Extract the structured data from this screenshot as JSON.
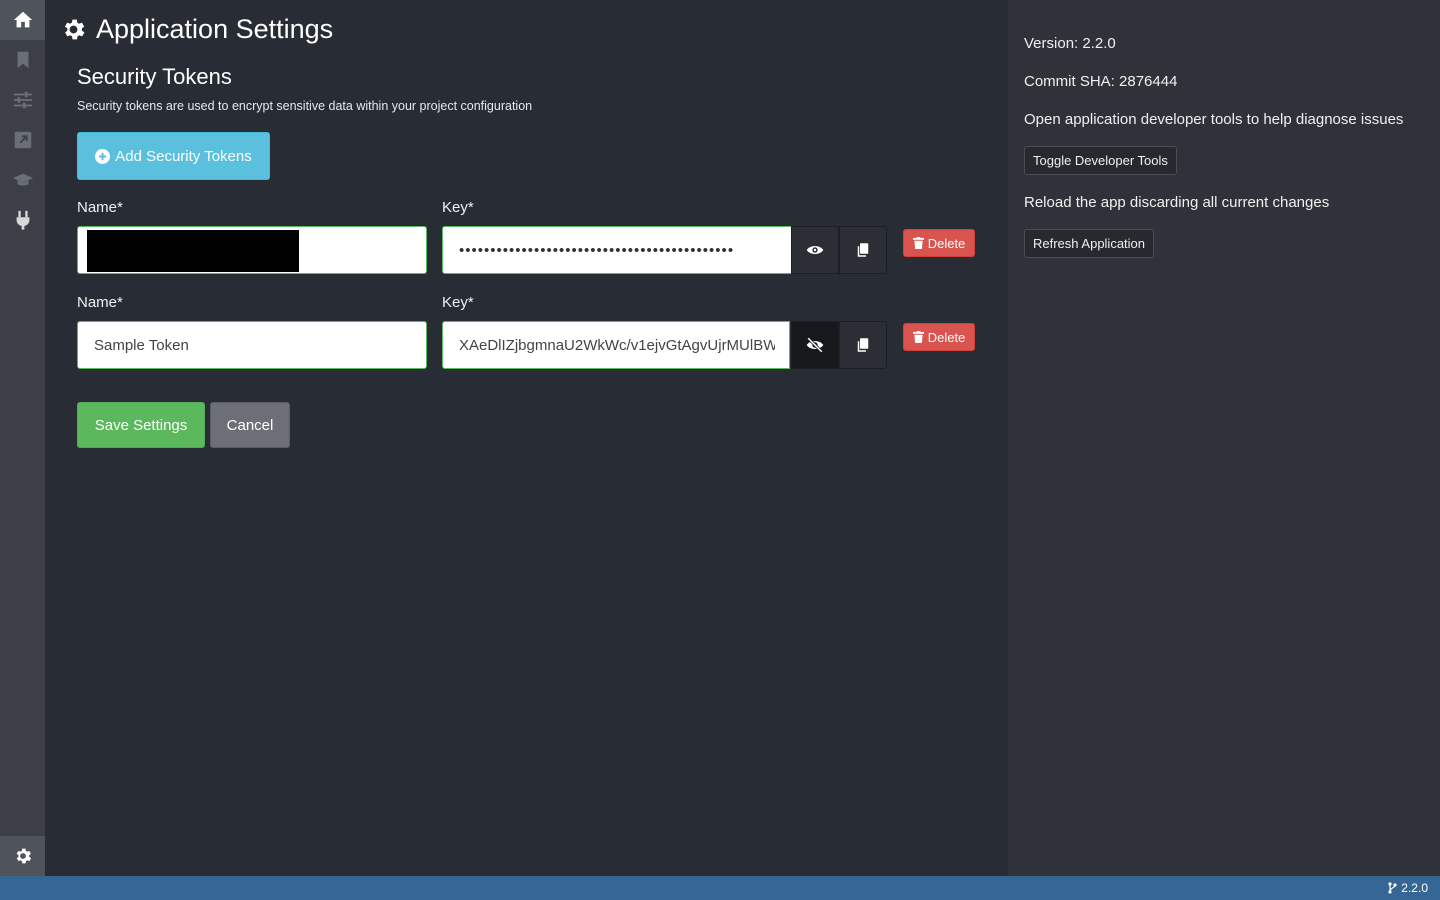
{
  "nav": {
    "items": [
      "home-icon",
      "bookmark-icon",
      "sliders-icon",
      "external-link-icon",
      "graduation-cap-icon",
      "plug-icon"
    ],
    "settings": "gear-icon"
  },
  "header": {
    "title": "Application Settings"
  },
  "tokens": {
    "section_title": "Security Tokens",
    "description": "Security tokens are used to encrypt sensitive data within your project configuration",
    "add_button": "Add Security Tokens",
    "rows": [
      {
        "name_label": "Name*",
        "name_value": "",
        "key_label": "Key*",
        "key_value": "••••••••••••••••••••••••••••••••••••••••••••",
        "key_visible": false,
        "delete_label": "Delete"
      },
      {
        "name_label": "Name*",
        "name_value": "Sample Token",
        "key_label": "Key*",
        "key_value": "XAeDlIZjbgmnaU2WkWc/v1ejvGtAgvUjrMUlBW",
        "key_visible": true,
        "delete_label": "Delete"
      }
    ],
    "save_button": "Save Settings",
    "cancel_button": "Cancel"
  },
  "side": {
    "version": "Version: 2.2.0",
    "commit": "Commit SHA: 2876444",
    "devtools_desc": "Open application developer tools to help diagnose issues",
    "devtools_button": "Toggle Developer Tools",
    "reload_desc": "Reload the app discarding all current changes",
    "reload_button": "Refresh Application"
  },
  "statusbar": {
    "version": "2.2.0"
  },
  "colors": {
    "primary_info": "#5bc0de",
    "success": "#5cb85c",
    "danger": "#d9534f",
    "statusbar": "#356694"
  }
}
